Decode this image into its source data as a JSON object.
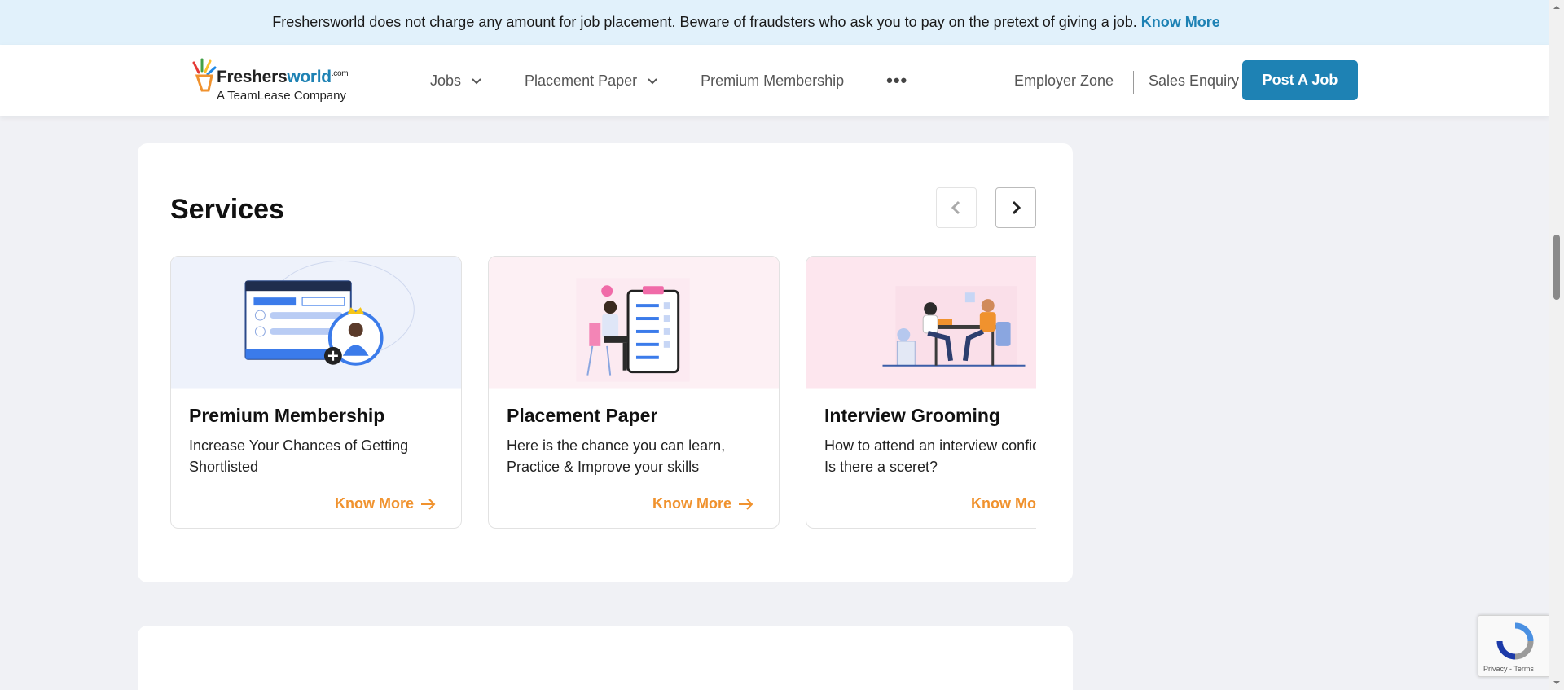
{
  "banner": {
    "text": "Freshersworld does not charge any amount for job placement. Beware of fraudsters who ask you to pay on the pretext of giving a job.",
    "link": "Know More"
  },
  "logo": {
    "brand_main": "Freshers",
    "brand_accent": "world",
    "brand_suffix": ".com",
    "tagline": "A TeamLease Company"
  },
  "nav": {
    "items": [
      {
        "label": "Jobs",
        "has_dropdown": true
      },
      {
        "label": "Placement Paper",
        "has_dropdown": true
      },
      {
        "label": "Premium Membership",
        "has_dropdown": false
      }
    ],
    "more_icon": "•••",
    "employer_zone": "Employer Zone",
    "sales_enquiry": "Sales Enquiry",
    "post_job": "Post A Job"
  },
  "services": {
    "title": "Services",
    "cards": [
      {
        "title": "Premium Membership",
        "description": "Increase Your Chances of Getting Shortlisted",
        "link": "Know More",
        "bg": "#eef2fb"
      },
      {
        "title": "Placement Paper",
        "description": "Here is the chance you can learn, Practice & Improve your skills",
        "link": "Know More",
        "bg": "#fdf0f4"
      },
      {
        "title": "Interview Grooming",
        "description": "How to attend an interview confidently? Is there a sceret?",
        "link": "Know Mo",
        "bg": "#fde6ee"
      }
    ]
  },
  "recaptcha": {
    "links": "Privacy - Terms"
  },
  "colors": {
    "accent": "#1e82b4",
    "orange": "#f0922e",
    "banner_bg": "#e1f1fb",
    "page_bg": "#f0f1f5"
  }
}
